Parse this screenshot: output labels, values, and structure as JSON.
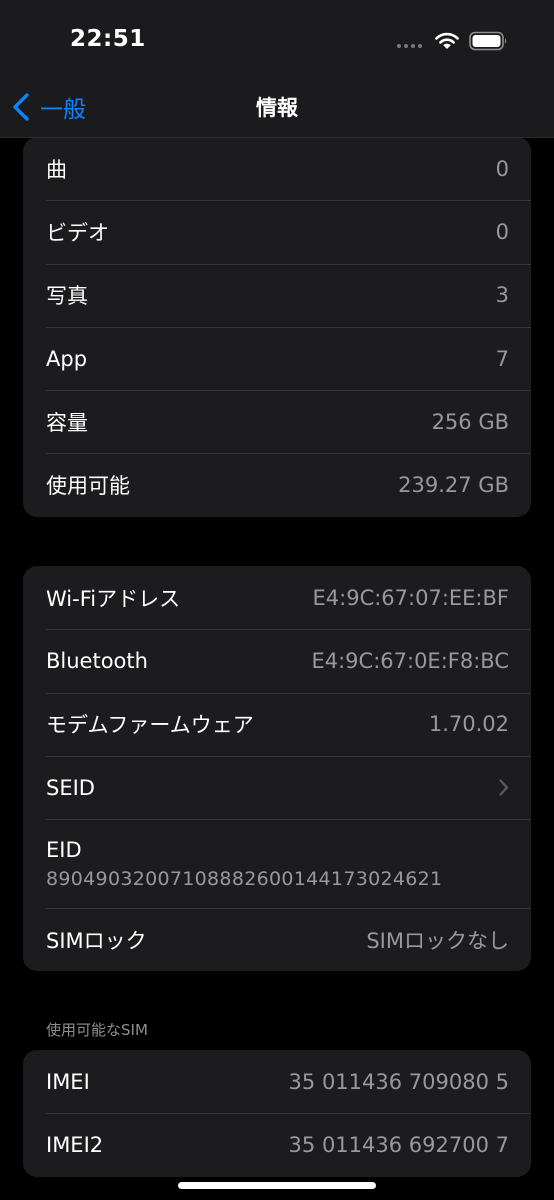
{
  "status_bar": {
    "time": "22:51"
  },
  "nav": {
    "back_label": "一般",
    "title": "情報"
  },
  "group1": {
    "rows": [
      {
        "label": "曲",
        "value": "0"
      },
      {
        "label": "ビデオ",
        "value": "0"
      },
      {
        "label": "写真",
        "value": "3"
      },
      {
        "label": "App",
        "value": "7"
      },
      {
        "label": "容量",
        "value": "256 GB"
      },
      {
        "label": "使用可能",
        "value": "239.27 GB"
      }
    ]
  },
  "group2": {
    "wifi": {
      "label": "Wi-Fiアドレス",
      "value": "E4:9C:67:07:EE:BF"
    },
    "bluetooth": {
      "label": "Bluetooth",
      "value": "E4:9C:67:0E:F8:BC"
    },
    "modem": {
      "label": "モデムファームウェア",
      "value": "1.70.02"
    },
    "seid": {
      "label": "SEID"
    },
    "eid": {
      "label": "EID",
      "value": "89049032007108882600144173024621"
    },
    "sim_lock": {
      "label": "SIMロック",
      "value": "SIMロックなし"
    }
  },
  "sim_section": {
    "header": "使用可能なSIM",
    "rows": [
      {
        "label": "IMEI",
        "value": "35 011436 709080 5"
      },
      {
        "label": "IMEI2",
        "value": "35 011436 692700 7"
      }
    ]
  },
  "colors": {
    "accent": "#0a84ff",
    "background": "#000000",
    "cell": "#1c1c1e",
    "secondary_text": "#98989e"
  }
}
